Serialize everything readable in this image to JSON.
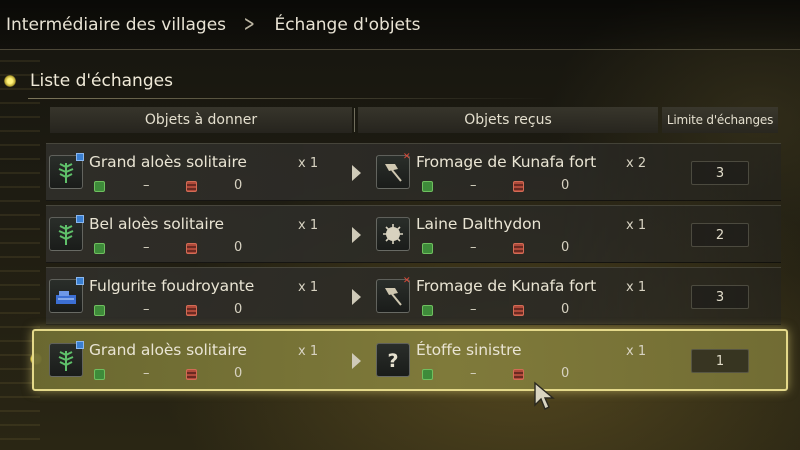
{
  "breadcrumb": {
    "parent": "Intermédiaire des villages",
    "current": "Échange d'objets"
  },
  "section": {
    "title": "Liste d'échanges"
  },
  "columns": {
    "give": "Objets à donner",
    "receive": "Objets reçus",
    "limit": "Limite d'échanges"
  },
  "rows": [
    {
      "give": {
        "name": "Grand aloès solitaire",
        "qty": "x 1",
        "icon": "aloe-plant-icon",
        "stock_a": "–",
        "stock_b": "0"
      },
      "receive": {
        "name": "Fromage de Kunafa fort",
        "qty": "x 2",
        "icon": "cheese-stick-icon",
        "stock_a": "–",
        "stock_b": "0"
      },
      "limit": "3",
      "selected": false
    },
    {
      "give": {
        "name": "Bel aloès solitaire",
        "qty": "x 1",
        "icon": "aloe-plant-icon",
        "stock_a": "–",
        "stock_b": "0"
      },
      "receive": {
        "name": "Laine Dalthydon",
        "qty": "x 1",
        "icon": "wool-icon",
        "stock_a": "–",
        "stock_b": "0"
      },
      "limit": "2",
      "selected": false
    },
    {
      "give": {
        "name": "Fulgurite foudroyante",
        "qty": "x 1",
        "icon": "fulgurite-ore-icon",
        "stock_a": "–",
        "stock_b": "0"
      },
      "receive": {
        "name": "Fromage de Kunafa fort",
        "qty": "x 1",
        "icon": "cheese-stick-icon",
        "stock_a": "–",
        "stock_b": "0"
      },
      "limit": "3",
      "selected": false
    },
    {
      "give": {
        "name": "Grand aloès solitaire",
        "qty": "x 1",
        "icon": "aloe-plant-icon",
        "stock_a": "–",
        "stock_b": "0"
      },
      "receive": {
        "name": "Étoffe sinistre",
        "qty": "x 1",
        "icon": "question-mark-icon",
        "stock_a": "–",
        "stock_b": "0"
      },
      "limit": "1",
      "selected": true
    }
  ],
  "colors": {
    "highlight": "#e4d98a",
    "stock_green": "#3e8b3a",
    "stock_red": "#b04a3a"
  }
}
